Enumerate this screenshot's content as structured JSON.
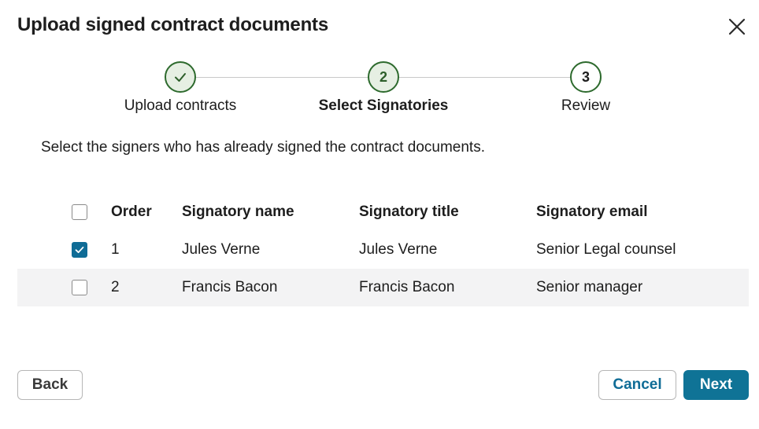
{
  "dialog": {
    "title": "Upload signed contract documents",
    "close_icon": "close-icon"
  },
  "stepper": {
    "steps": [
      {
        "number": "1",
        "label": "Upload contracts",
        "status": "completed",
        "icon": "check-icon"
      },
      {
        "number": "2",
        "label": "Select Signatories",
        "status": "active"
      },
      {
        "number": "3",
        "label": "Review",
        "status": "pending"
      }
    ]
  },
  "instruction": "Select the signers who has already signed the contract documents.",
  "table": {
    "columns": [
      "Order",
      "Signatory name",
      "Signatory title",
      "Signatory email"
    ],
    "select_all_checked": false,
    "rows": [
      {
        "checked": true,
        "order": "1",
        "name": "Jules Verne",
        "title": "Jules Verne",
        "email": "Senior Legal counsel"
      },
      {
        "checked": false,
        "order": "2",
        "name": "Francis Bacon",
        "title": "Francis Bacon",
        "email": "Senior manager"
      }
    ]
  },
  "footer": {
    "back_label": "Back",
    "cancel_label": "Cancel",
    "next_label": "Next"
  },
  "colors": {
    "primary": "#0f7396",
    "step_accent": "#2d6a2d",
    "step_fill": "#e6efe3",
    "row_shade": "#f3f3f4"
  }
}
